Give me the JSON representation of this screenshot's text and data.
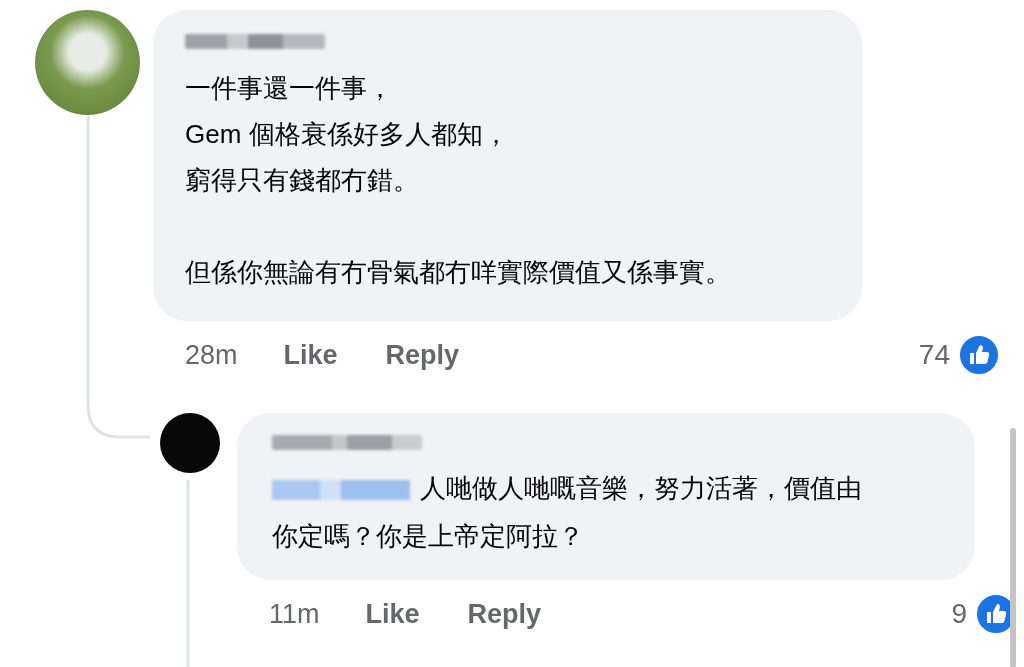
{
  "comments": [
    {
      "paragraphs": [
        [
          "一件事還一件事，",
          "Gem 個格衰係好多人都知，",
          "窮得只有錢都冇錯。"
        ],
        [
          "但係你無論有冇骨氣都冇咩實際價值又係事實。"
        ]
      ],
      "time": "28m",
      "like_label": "Like",
      "reply_label": "Reply",
      "reaction_count": "74"
    }
  ],
  "replies": [
    {
      "text_lines": [
        "人哋做人哋嘅音樂，努力活著，價值由",
        "你定嗎？你是上帝定阿拉？"
      ],
      "time": "11m",
      "like_label": "Like",
      "reply_label": "Reply",
      "reaction_count": "9"
    }
  ]
}
